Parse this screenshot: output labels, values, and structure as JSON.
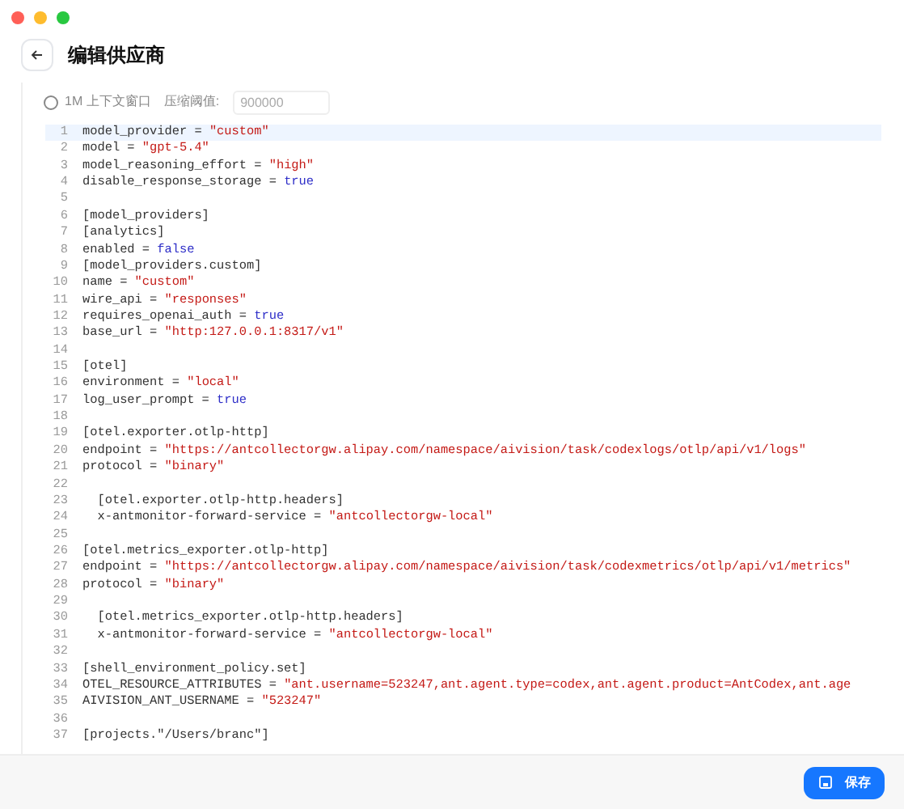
{
  "header": {
    "title": "编辑供应商"
  },
  "options": {
    "context_1m": {
      "label": "1M 上下文窗口",
      "checked": false
    },
    "threshold": {
      "label": "压缩阈值:",
      "placeholder": "900000"
    }
  },
  "editor": {
    "lines": [
      {
        "number": "1",
        "selected": true,
        "segments": [
          {
            "kind": "plain",
            "text": "model_provider = "
          },
          {
            "kind": "string",
            "text": "\"custom\""
          }
        ]
      },
      {
        "number": "2",
        "selected": false,
        "segments": [
          {
            "kind": "plain",
            "text": "model = "
          },
          {
            "kind": "string",
            "text": "\"gpt-5.4\""
          }
        ]
      },
      {
        "number": "3",
        "selected": false,
        "segments": [
          {
            "kind": "plain",
            "text": "model_reasoning_effort = "
          },
          {
            "kind": "string",
            "text": "\"high\""
          }
        ]
      },
      {
        "number": "4",
        "selected": false,
        "segments": [
          {
            "kind": "plain",
            "text": "disable_response_storage = "
          },
          {
            "kind": "keyword",
            "text": "true"
          }
        ]
      },
      {
        "number": "5",
        "selected": false
      },
      {
        "number": "6",
        "selected": false,
        "segments": [
          {
            "kind": "plain",
            "text": "[model_providers]"
          }
        ]
      },
      {
        "number": "7",
        "selected": false,
        "segments": [
          {
            "kind": "plain",
            "text": "[analytics]"
          }
        ]
      },
      {
        "number": "8",
        "selected": false,
        "segments": [
          {
            "kind": "plain",
            "text": "enabled = "
          },
          {
            "kind": "keyword",
            "text": "false"
          }
        ]
      },
      {
        "number": "9",
        "selected": false,
        "segments": [
          {
            "kind": "plain",
            "text": "[model_providers.custom]"
          }
        ]
      },
      {
        "number": "10",
        "selected": false,
        "segments": [
          {
            "kind": "plain",
            "text": "name = "
          },
          {
            "kind": "string",
            "text": "\"custom\""
          }
        ]
      },
      {
        "number": "11",
        "selected": false,
        "segments": [
          {
            "kind": "plain",
            "text": "wire_api = "
          },
          {
            "kind": "string",
            "text": "\"responses\""
          }
        ]
      },
      {
        "number": "12",
        "selected": false,
        "segments": [
          {
            "kind": "plain",
            "text": "requires_openai_auth = "
          },
          {
            "kind": "keyword",
            "text": "true"
          }
        ]
      },
      {
        "number": "13",
        "selected": false,
        "segments": [
          {
            "kind": "plain",
            "text": "base_url = "
          },
          {
            "kind": "string",
            "text": "\"http:127.0.0.1:8317/v1\""
          }
        ]
      },
      {
        "number": "14",
        "selected": false
      },
      {
        "number": "15",
        "selected": false,
        "segments": [
          {
            "kind": "plain",
            "text": "[otel]"
          }
        ]
      },
      {
        "number": "16",
        "selected": false,
        "segments": [
          {
            "kind": "plain",
            "text": "environment = "
          },
          {
            "kind": "string",
            "text": "\"local\""
          }
        ]
      },
      {
        "number": "17",
        "selected": false,
        "segments": [
          {
            "kind": "plain",
            "text": "log_user_prompt = "
          },
          {
            "kind": "keyword",
            "text": "true"
          }
        ]
      },
      {
        "number": "18",
        "selected": false
      },
      {
        "number": "19",
        "selected": false,
        "segments": [
          {
            "kind": "plain",
            "text": "[otel.exporter.otlp-http]"
          }
        ]
      },
      {
        "number": "20",
        "selected": false,
        "segments": [
          {
            "kind": "plain",
            "text": "endpoint = "
          },
          {
            "kind": "string",
            "text": "\"https://antcollectorgw.alipay.com/namespace/aivision/task/codexlogs/otlp/api/v1/logs\""
          }
        ]
      },
      {
        "number": "21",
        "selected": false,
        "segments": [
          {
            "kind": "plain",
            "text": "protocol = "
          },
          {
            "kind": "string",
            "text": "\"binary\""
          }
        ]
      },
      {
        "number": "22",
        "selected": false
      },
      {
        "number": "23",
        "selected": false,
        "segments": [
          {
            "kind": "plain",
            "text": "  [otel.exporter.otlp-http.headers]"
          }
        ]
      },
      {
        "number": "24",
        "selected": false,
        "segments": [
          {
            "kind": "plain",
            "text": "  x-antmonitor-forward-service = "
          },
          {
            "kind": "string",
            "text": "\"antcollectorgw-local\""
          }
        ]
      },
      {
        "number": "25",
        "selected": false
      },
      {
        "number": "26",
        "selected": false,
        "segments": [
          {
            "kind": "plain",
            "text": "[otel.metrics_exporter.otlp-http]"
          }
        ]
      },
      {
        "number": "27",
        "selected": false,
        "segments": [
          {
            "kind": "plain",
            "text": "endpoint = "
          },
          {
            "kind": "string",
            "text": "\"https://antcollectorgw.alipay.com/namespace/aivision/task/codexmetrics/otlp/api/v1/metrics\""
          }
        ]
      },
      {
        "number": "28",
        "selected": false,
        "segments": [
          {
            "kind": "plain",
            "text": "protocol = "
          },
          {
            "kind": "string",
            "text": "\"binary\""
          }
        ]
      },
      {
        "number": "29",
        "selected": false
      },
      {
        "number": "30",
        "selected": false,
        "segments": [
          {
            "kind": "plain",
            "text": "  [otel.metrics_exporter.otlp-http.headers]"
          }
        ]
      },
      {
        "number": "31",
        "selected": false,
        "segments": [
          {
            "kind": "plain",
            "text": "  x-antmonitor-forward-service = "
          },
          {
            "kind": "string",
            "text": "\"antcollectorgw-local\""
          }
        ]
      },
      {
        "number": "32",
        "selected": false
      },
      {
        "number": "33",
        "selected": false,
        "segments": [
          {
            "kind": "plain",
            "text": "[shell_environment_policy.set]"
          }
        ]
      },
      {
        "number": "34",
        "selected": false,
        "segments": [
          {
            "kind": "plain",
            "text": "OTEL_RESOURCE_ATTRIBUTES = "
          },
          {
            "kind": "string",
            "text": "\"ant.username=523247,ant.agent.type=codex,ant.agent.product=AntCodex,ant.age"
          }
        ]
      },
      {
        "number": "35",
        "selected": false,
        "segments": [
          {
            "kind": "plain",
            "text": "AIVISION_ANT_USERNAME = "
          },
          {
            "kind": "string",
            "text": "\"523247\""
          }
        ]
      },
      {
        "number": "36",
        "selected": false
      },
      {
        "number": "37",
        "selected": false,
        "segments": [
          {
            "kind": "plain",
            "text": "[projects.\"/Users/branc\"]"
          }
        ]
      }
    ]
  },
  "footer": {
    "save_button": "保存"
  }
}
